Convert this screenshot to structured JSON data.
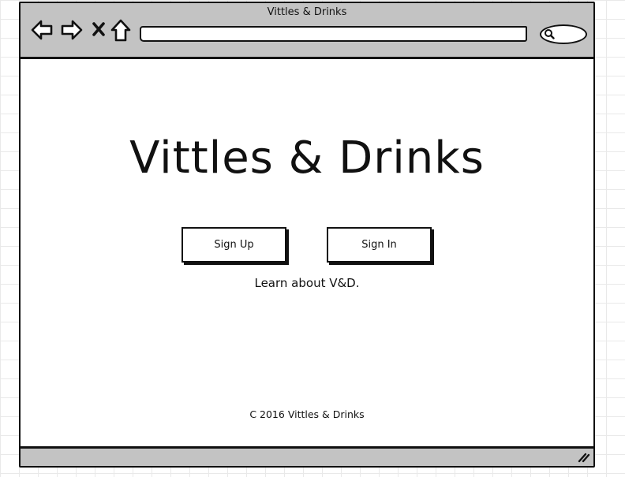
{
  "window": {
    "title": "Vittles & Drinks"
  },
  "toolbar": {
    "icons": [
      "back-arrow-icon",
      "forward-arrow-icon",
      "close-x-icon",
      "home-icon"
    ],
    "address_value": "",
    "search_value": ""
  },
  "page": {
    "heading": "Vittles & Drinks",
    "sign_up_label": "Sign Up",
    "sign_in_label": "Sign In",
    "learn_link": "Learn about V&D.",
    "footer": "C 2016 Vittles & Drinks"
  },
  "colors": {
    "chrome": "#c3c3c3",
    "ink": "#111111",
    "canvas_grid": "#e9e9e9"
  }
}
